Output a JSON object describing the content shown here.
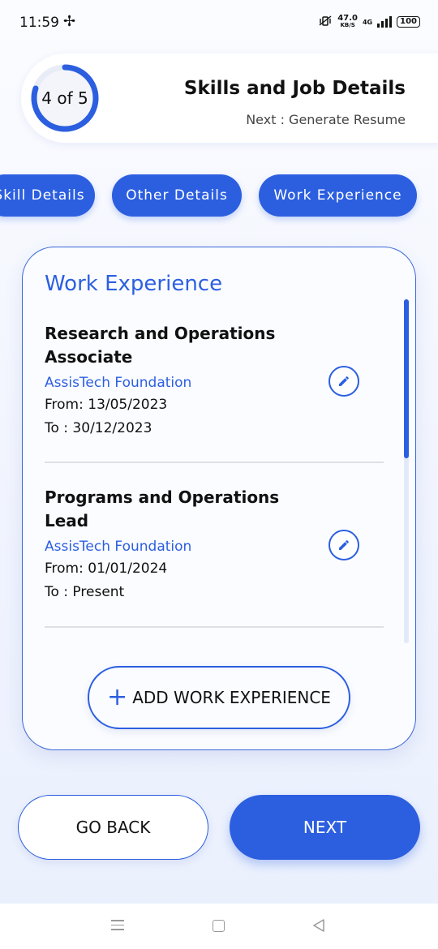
{
  "status_bar": {
    "time": "11:59",
    "net_speed": "47.0",
    "net_unit": "KB/S",
    "network": "4G",
    "battery": "100"
  },
  "header": {
    "progress": "4 of 5",
    "progress_fraction": 0.8,
    "title": "Skills and Job Details",
    "next_step": "Next : Generate Resume"
  },
  "tabs": [
    {
      "label": "Skill Details"
    },
    {
      "label": "Other Details"
    },
    {
      "label": "Work Experience"
    }
  ],
  "card": {
    "title": "Work Experience",
    "entries": [
      {
        "role": "Research and Operations Associate",
        "organization": "AssisTech Foundation",
        "from": "From: 13/05/2023",
        "to": "To : 30/12/2023"
      },
      {
        "role": "Programs and Operations Lead",
        "organization": "AssisTech Foundation",
        "from": "From: 01/01/2024",
        "to": "To : Present"
      }
    ],
    "add_button": "ADD WORK EXPERIENCE"
  },
  "actions": {
    "back": "GO BACK",
    "next": "NEXT"
  },
  "colors": {
    "accent": "#2c5fe0",
    "track": "#e8ecf7"
  }
}
